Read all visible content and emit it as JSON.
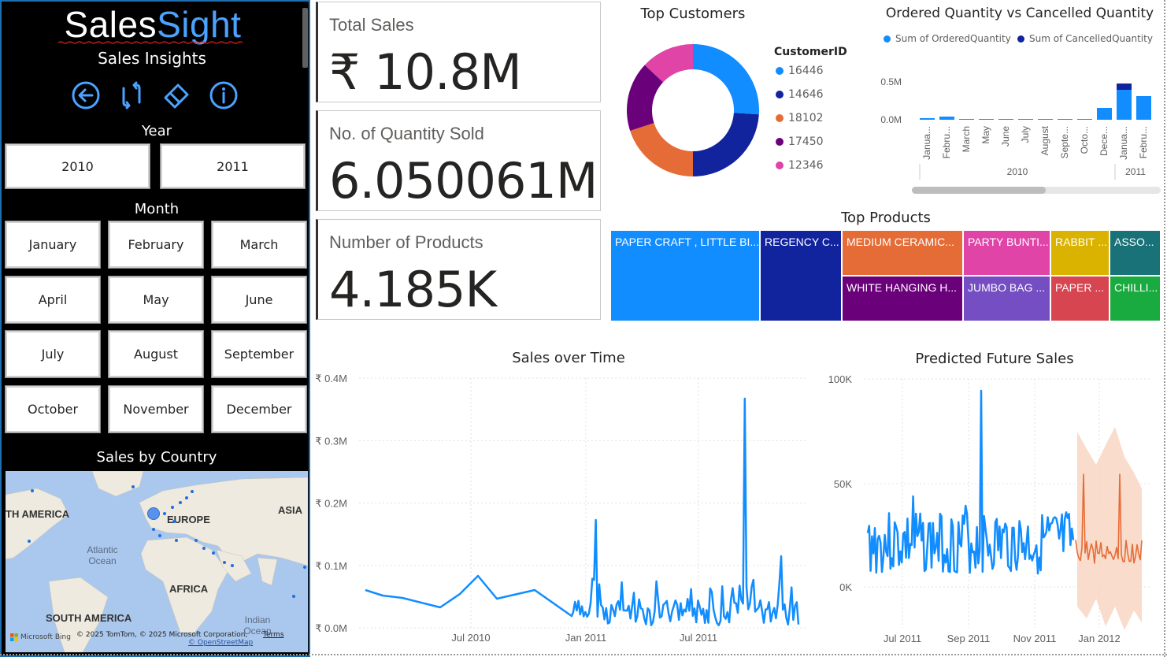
{
  "sidebar": {
    "brand_part1": "Sales",
    "brand_part2": "Sight",
    "subtitle": "Sales Insights",
    "nav_icons": [
      "back-arrow-icon",
      "refresh-icon",
      "eraser-icon",
      "info-icon"
    ],
    "year_title": "Year",
    "years": [
      "2010",
      "2011"
    ],
    "month_title": "Month",
    "months": [
      "January",
      "February",
      "March",
      "April",
      "May",
      "June",
      "July",
      "August",
      "September",
      "October",
      "November",
      "December"
    ],
    "map_title": "Sales by Country",
    "map": {
      "labels": [
        "TH AMERICA",
        "EUROPE",
        "ASIA",
        "AFRICA",
        "SOUTH AMERICA"
      ],
      "oceans": [
        "Atlantic Ocean",
        "Indian Ocean"
      ],
      "copyright": "© 2025 TomTom, © 2025 Microsoft Corporation,",
      "terms": "Terms",
      "osm": "© OpenStreetMap",
      "bing": "Microsoft Bing"
    }
  },
  "cards": [
    {
      "label": "Total Sales",
      "value": "₹ 10.8M"
    },
    {
      "label": "No. of Quantity Sold",
      "value": "6.050061M"
    },
    {
      "label": "Number of Products",
      "value": "4.185K"
    }
  ],
  "top_customers": {
    "title": "Top Customers",
    "legend_title": "CustomerID",
    "items": [
      {
        "id": "16446",
        "color": "#118dff",
        "value": 26
      },
      {
        "id": "14646",
        "color": "#12239e",
        "value": 24
      },
      {
        "id": "18102",
        "color": "#e66c37",
        "value": 20
      },
      {
        "id": "17450",
        "color": "#6b007b",
        "value": 17
      },
      {
        "id": "12346",
        "color": "#e044a7",
        "value": 13
      }
    ]
  },
  "qty_chart": {
    "title": "Ordered Quantity vs Cancelled Quantity",
    "legend": [
      {
        "name": "Sum of OrderedQuantity",
        "color": "#118dff"
      },
      {
        "name": "Sum of CancelledQuantity",
        "color": "#12239e"
      }
    ],
    "y_ticks": [
      "0.5M",
      "0.0M"
    ],
    "months": [
      "Janua...",
      "Febru...",
      "March",
      "May",
      "June",
      "July",
      "August",
      "Septe...",
      "Octo...",
      "Dece...",
      "Janua...",
      "Febru..."
    ],
    "years": [
      "2010",
      "2011"
    ]
  },
  "top_products": {
    "title": "Top Products",
    "tiles": [
      {
        "label": "PAPER CRAFT , LITTLE BI...",
        "color": "#118dff"
      },
      {
        "label": "REGENCY C...",
        "color": "#12239e"
      },
      {
        "label": "MEDIUM CERAMIC...",
        "color": "#e66c37"
      },
      {
        "label": "WHITE HANGING H...",
        "color": "#6b007b"
      },
      {
        "label": "PARTY BUNTI...",
        "color": "#e044a7"
      },
      {
        "label": "JUMBO BAG ...",
        "color": "#744ec2"
      },
      {
        "label": "RABBIT ...",
        "color": "#d9b300"
      },
      {
        "label": "PAPER ...",
        "color": "#d64550"
      },
      {
        "label": "ASSO...",
        "color": "#197278"
      },
      {
        "label": "CHILLI...",
        "color": "#1aab40"
      }
    ]
  },
  "sales_time": {
    "title": "Sales over Time",
    "y_ticks": [
      "₹ 0.4M",
      "₹ 0.3M",
      "₹ 0.2M",
      "₹ 0.1M",
      "₹ 0.0M"
    ],
    "x_ticks": [
      "Jul 2010",
      "Jan 2011",
      "Jul 2011"
    ],
    "color": "#118dff"
  },
  "predicted": {
    "title": "Predicted Future Sales",
    "y_ticks": [
      "100K",
      "50K",
      "0K"
    ],
    "x_ticks": [
      "Jul 2011",
      "Sep 2011",
      "Nov 2011",
      "Jan 2012"
    ],
    "actual_color": "#118dff",
    "forecast_color": "#e66c37",
    "band_color": "#f7d3be"
  }
}
